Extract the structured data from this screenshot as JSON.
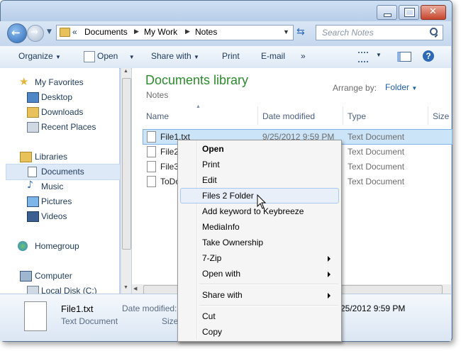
{
  "address": {
    "parts": [
      "Documents",
      "My Work",
      "Notes"
    ]
  },
  "search": {
    "placeholder": "Search Notes"
  },
  "toolbar": {
    "organize": "Organize",
    "open": "Open",
    "share_with": "Share with",
    "print": "Print",
    "email": "E-mail",
    "more": "»"
  },
  "nav": {
    "favorites": "My Favorites",
    "desktop": "Desktop",
    "downloads": "Downloads",
    "recent": "Recent Places",
    "libraries": "Libraries",
    "documents": "Documents",
    "music": "Music",
    "pictures": "Pictures",
    "videos": "Videos",
    "homegroup": "Homegroup",
    "computer": "Computer",
    "local_disk": "Local Disk (C:)"
  },
  "library": {
    "title": "Documents library",
    "subtitle": "Notes",
    "arrange_label": "Arrange by:",
    "arrange_value": "Folder"
  },
  "columns": {
    "name": "Name",
    "date": "Date modified",
    "type": "Type",
    "size": "Size"
  },
  "files": [
    {
      "name": "File1.txt",
      "date": "9/25/2012 9:59 PM",
      "type": "Text Document"
    },
    {
      "name": "File2",
      "date": "",
      "type": "Text Document"
    },
    {
      "name": "File3",
      "date": "",
      "type": "Text Document"
    },
    {
      "name": "ToDo",
      "date": "",
      "type": "Text Document"
    }
  ],
  "context_menu": {
    "items": [
      "Open",
      "Print",
      "Edit",
      "Files 2 Folder",
      "Add keyword to Keybreeze",
      "MediaInfo",
      "Take Ownership",
      "7-Zip",
      "Open with",
      "Share with",
      "Cut",
      "Copy"
    ]
  },
  "details": {
    "filename": "File1.txt",
    "filetype": "Text Document",
    "date_label": "Date modified:",
    "date_value": "25/2012 9:59 PM",
    "size_label": "Size:"
  },
  "colors": {
    "accent": "#2c8c2c",
    "link": "#1e5fa8",
    "hover": "#dde9f7"
  }
}
